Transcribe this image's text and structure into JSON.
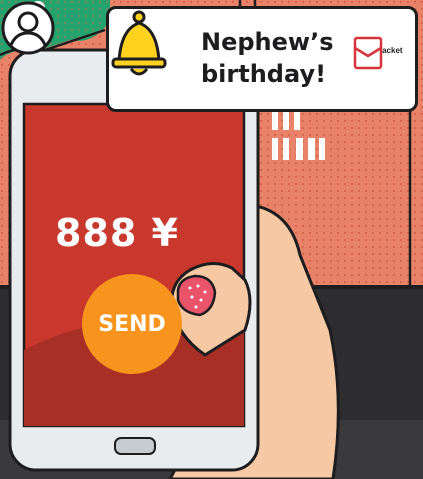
{
  "notification": {
    "title": "Nephew’s birthday!",
    "app_label": "Red Packet",
    "bell_icon": "bell-icon",
    "app_icon": "red-packet-icon"
  },
  "phone": {
    "avatar_icon": "user-avatar-icon",
    "amount": "888 ¥",
    "send_label": "SEND"
  },
  "colors": {
    "background_salmon": "#e8836a",
    "background_green": "#25a36f",
    "phone_screen_red": "#c8382c",
    "send_orange": "#f7941d",
    "bell_yellow": "#ffd21f"
  }
}
